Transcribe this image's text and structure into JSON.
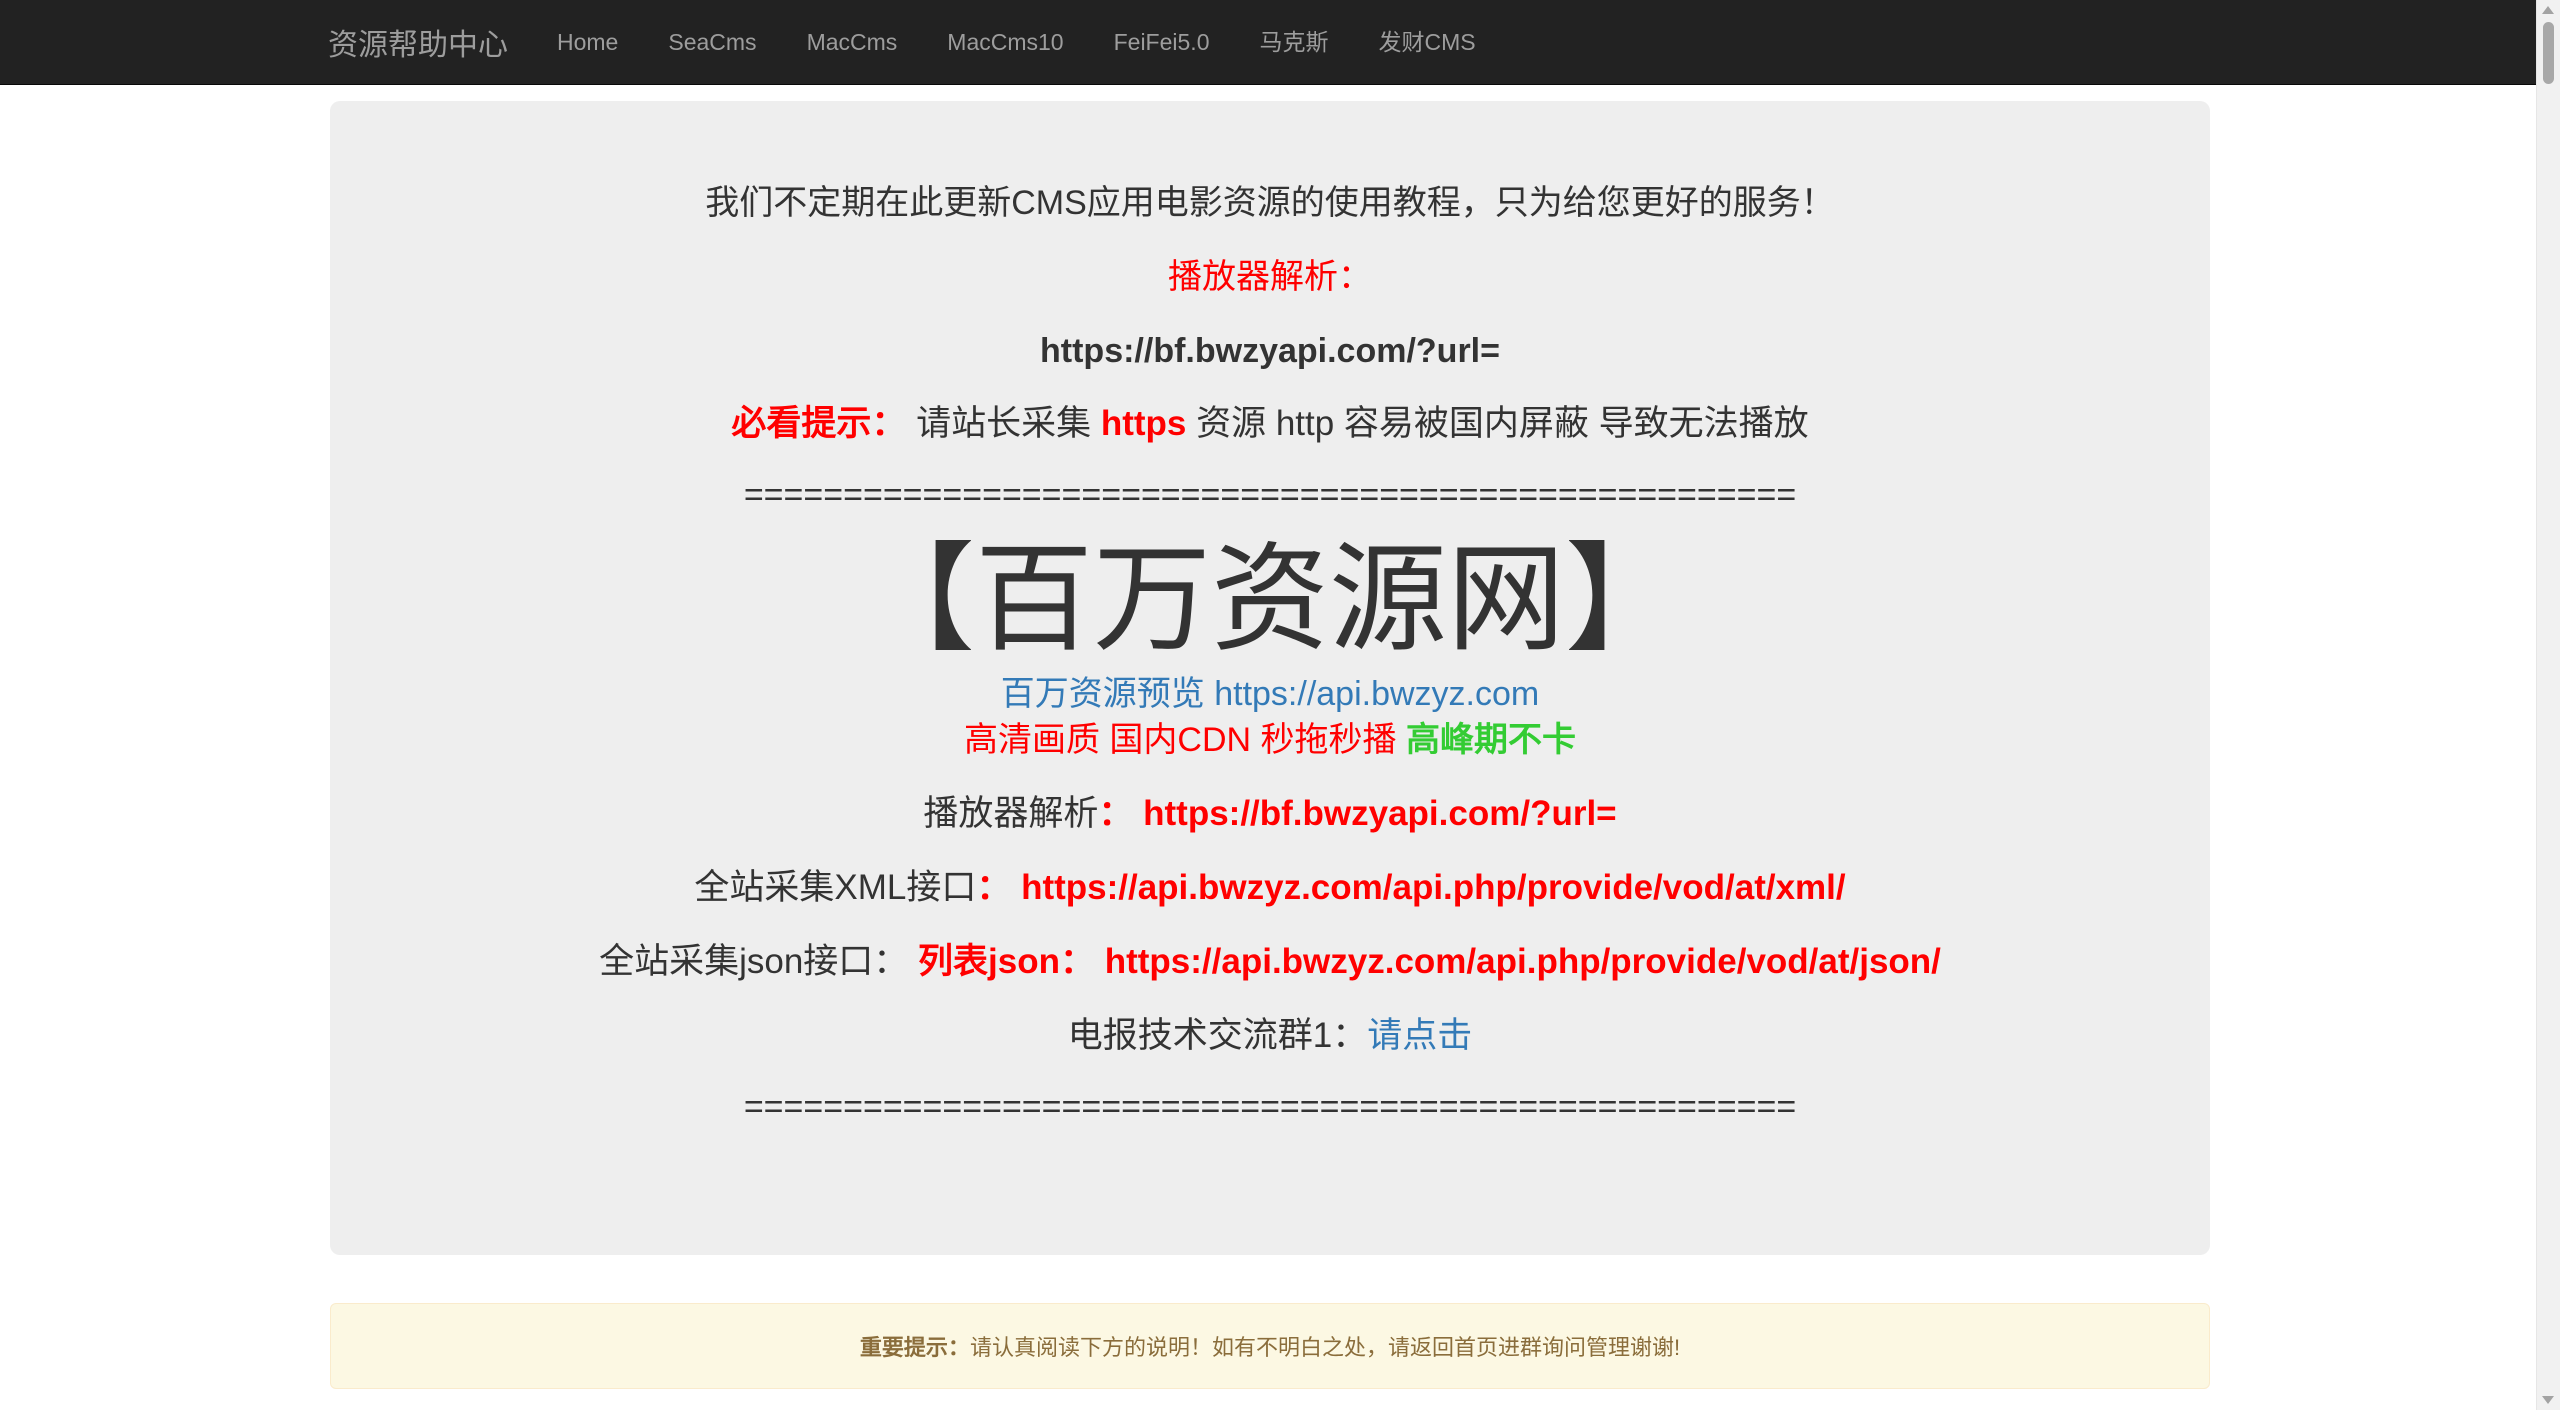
{
  "navbar": {
    "brand": "资源帮助中心",
    "items": [
      "Home",
      "SeaCms",
      "MacCms",
      "MacCms10",
      "FeiFei5.0",
      "马克斯",
      "发财CMS"
    ]
  },
  "jumbotron": {
    "intro": "我们不定期在此更新CMS应用电影资源的使用教程，只为给您更好的服务！",
    "player_title": "播放器解析：",
    "player_url": "https://bf.bwzyapi.com/?url=",
    "tip_label": "必看提示：",
    "tip_text_1": "请站长采集",
    "tip_https": "https",
    "tip_text_2": "资源 http 容易被国内屏蔽 导致无法播放",
    "divider": "=====================================================",
    "site_title": "【百万资源网】",
    "preview_label": "百万资源预览",
    "preview_url": "https://api.bwzyz.com",
    "hd_text": "高清画质 国内CDN 秒拖秒播",
    "hd_peak": "高峰期不卡",
    "player_label": "播放器解析",
    "colon": "：",
    "player_url_2": "https://bf.bwzyapi.com/?url=",
    "xml_label": "全站采集XML接口",
    "xml_url": "https://api.bwzyz.com/api.php/provide/vod/at/xml/",
    "json_label": "全站采集json接口：",
    "json_list_label": "列表json：",
    "json_url": "https://api.bwzyz.com/api.php/provide/vod/at/json/",
    "tg_label": "电报技术交流群1：",
    "tg_link": "请点击"
  },
  "alert": {
    "label": "重要提示：",
    "text": "请认真阅读下方的说明！如有不明白之处，请返回首页进群询问管理谢谢!"
  }
}
